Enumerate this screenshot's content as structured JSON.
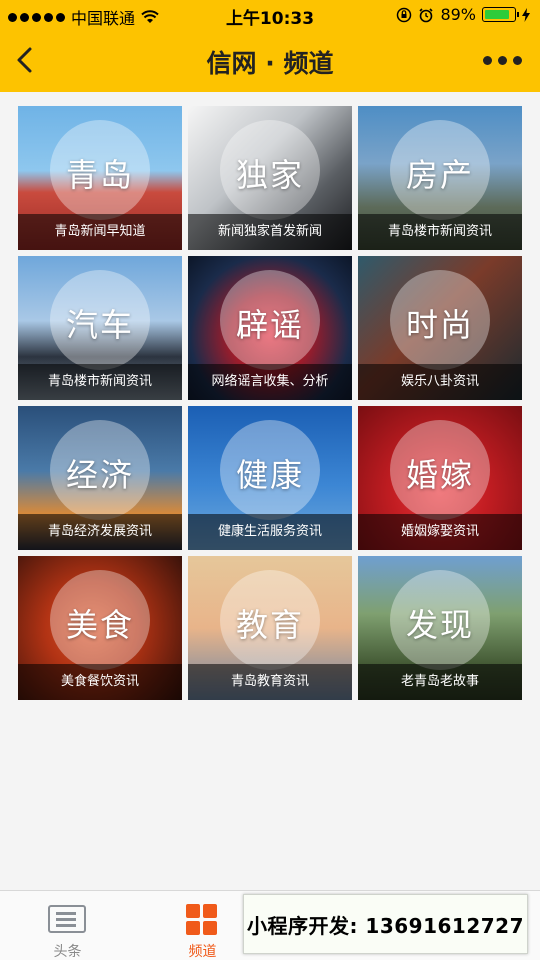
{
  "status_bar": {
    "carrier": "中国联通",
    "time": "上午10:33",
    "battery": "89%",
    "battery_level": 0.89
  },
  "nav": {
    "title": "信网 · 频道",
    "back_icon": "chevron-left-icon",
    "more_icon": "more-dots-icon"
  },
  "channels": [
    {
      "title": "青岛",
      "caption": "青岛新闻早知道"
    },
    {
      "title": "独家",
      "caption": "新闻独家首发新闻"
    },
    {
      "title": "房产",
      "caption": "青岛楼市新闻资讯"
    },
    {
      "title": "汽车",
      "caption": "青岛楼市新闻资讯"
    },
    {
      "title": "辟谣",
      "caption": "网络谣言收集、分析"
    },
    {
      "title": "时尚",
      "caption": "娱乐八卦资讯"
    },
    {
      "title": "经济",
      "caption": "青岛经济发展资讯"
    },
    {
      "title": "健康",
      "caption": "健康生活服务资讯"
    },
    {
      "title": "婚嫁",
      "caption": "婚姻嫁娶资讯"
    },
    {
      "title": "美食",
      "caption": "美食餐饮资讯"
    },
    {
      "title": "教育",
      "caption": "青岛教育资讯"
    },
    {
      "title": "发现",
      "caption": "老青岛老故事"
    }
  ],
  "tabbar": {
    "tabs": [
      {
        "label": "头条",
        "icon": "list-icon"
      },
      {
        "label": "频道",
        "icon": "grid-icon"
      }
    ],
    "active_color": "#f05a1a"
  },
  "promo": {
    "text": "小程序开发: 13691612727"
  },
  "colors": {
    "header": "#fdc300"
  }
}
